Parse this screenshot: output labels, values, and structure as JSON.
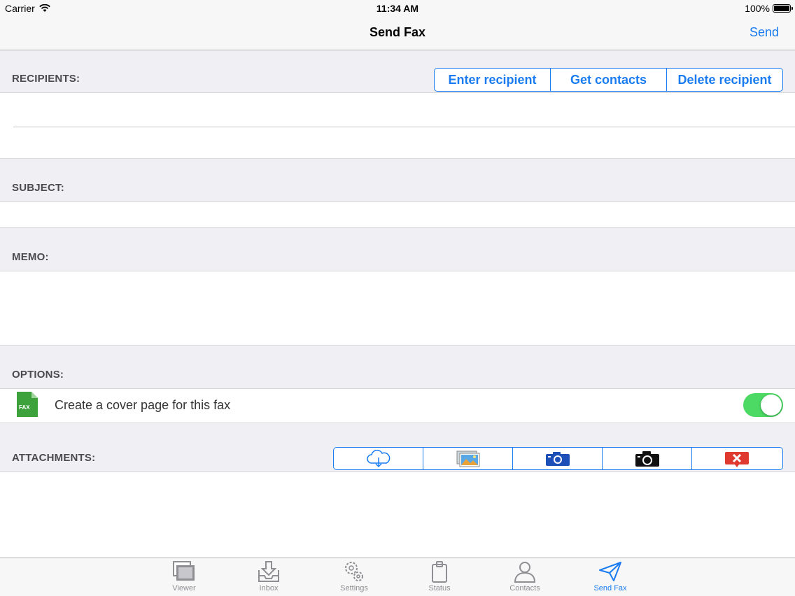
{
  "status_bar": {
    "carrier": "Carrier",
    "time": "11:34 AM",
    "battery": "100%"
  },
  "nav": {
    "title": "Send Fax",
    "send_label": "Send"
  },
  "recipients": {
    "header": "RECIPIENTS:",
    "buttons": [
      "Enter recipient",
      "Get contacts",
      "Delete recipient"
    ]
  },
  "subject": {
    "header": "SUBJECT:"
  },
  "memo": {
    "header": "MEMO:"
  },
  "options": {
    "header": "OPTIONS:",
    "cover_page_label": "Create a cover page for this fax",
    "cover_page_enabled": true,
    "fax_icon_text": "FAX"
  },
  "attachments": {
    "header": "ATTACHMENTS:",
    "buttons": [
      "cloud-download-icon",
      "photos-icon",
      "camera-blue-icon",
      "camera-black-icon",
      "delete-attachment-icon"
    ]
  },
  "tabs": [
    {
      "label": "Viewer",
      "icon": "viewer-icon",
      "active": false
    },
    {
      "label": "Inbox",
      "icon": "inbox-icon",
      "active": false
    },
    {
      "label": "Settings",
      "icon": "gear-icon",
      "active": false
    },
    {
      "label": "Status",
      "icon": "clipboard-icon",
      "active": false
    },
    {
      "label": "Contacts",
      "icon": "person-icon",
      "active": false
    },
    {
      "label": "Send Fax",
      "icon": "paper-plane-icon",
      "active": true
    }
  ],
  "colors": {
    "accent": "#1a7cf0",
    "toggle_on": "#4cd964",
    "fax_green": "#3da23c",
    "delete_red": "#e03a30"
  }
}
